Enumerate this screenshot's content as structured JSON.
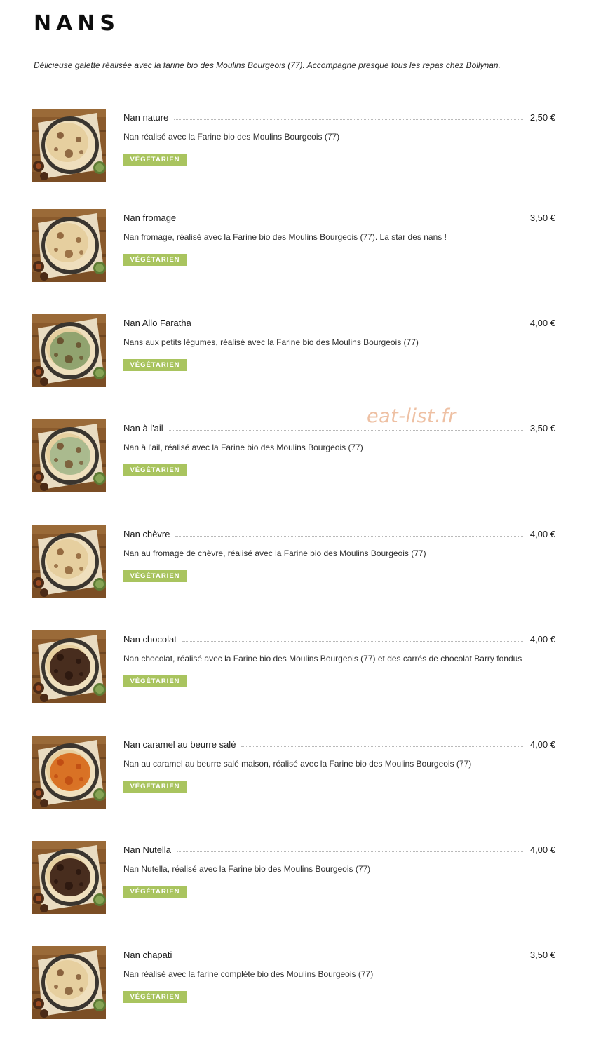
{
  "title": "NANS",
  "intro": "Délicieuse galette réalisée avec la farine bio des Moulins Bourgeois (77). Accompagne presque tous les repas chez Bollynan.",
  "watermark": "eat-list.fr",
  "colors": {
    "badge_green": "#a9c45f",
    "watermark": "#eec0a3",
    "wood": "#8a5a2c"
  },
  "items": [
    {
      "name": "Nan nature",
      "price": "2,50 €",
      "description": "Nan réalisé avec la Farine bio des Moulins Bourgeois (77)",
      "badge": "VÉGÉTARIEN",
      "topping": "plain"
    },
    {
      "name": "Nan fromage",
      "price": "3,50 €",
      "description": "Nan fromage, réalisé avec la Farine bio des Moulins Bourgeois (77). La star des nans !",
      "badge": "VÉGÉTARIEN",
      "topping": "cheese"
    },
    {
      "name": "Nan Allo Faratha",
      "price": "4,00 €",
      "description": "Nans aux petits légumes, réalisé avec la Farine bio des Moulins Bourgeois (77)",
      "badge": "VÉGÉTARIEN",
      "topping": "vegetables"
    },
    {
      "name": "Nan à l'ail",
      "price": "3,50 €",
      "description": "Nan à l'ail, réalisé avec la Farine bio des Moulins Bourgeois (77)",
      "badge": "VÉGÉTARIEN",
      "topping": "garlic"
    },
    {
      "name": "Nan chèvre",
      "price": "4,00 €",
      "description": "Nan au fromage de chèvre, réalisé avec la Farine bio des Moulins Bourgeois (77)",
      "badge": "VÉGÉTARIEN",
      "topping": "goat-cheese"
    },
    {
      "name": "Nan chocolat",
      "price": "4,00 €",
      "description": "Nan chocolat, réalisé avec la Farine bio des Moulins Bourgeois (77) et des carrés de chocolat Barry fondus",
      "badge": "VÉGÉTARIEN",
      "topping": "chocolate"
    },
    {
      "name": "Nan caramel au beurre salé",
      "price": "4,00 €",
      "description": "Nan au caramel au beurre salé maison, réalisé avec la Farine bio des Moulins Bourgeois (77)",
      "badge": "VÉGÉTARIEN",
      "topping": "caramel"
    },
    {
      "name": "Nan Nutella",
      "price": "4,00 €",
      "description": "Nan Nutella, réalisé avec la Farine bio des Moulins Bourgeois (77)",
      "badge": "VÉGÉTARIEN",
      "topping": "chocolate"
    },
    {
      "name": "Nan chapati",
      "price": "3,50 €",
      "description": "Nan réalisé avec la farine complète bio des Moulins Bourgeois (77)",
      "badge": "VÉGÉTARIEN",
      "topping": "plain"
    }
  ]
}
